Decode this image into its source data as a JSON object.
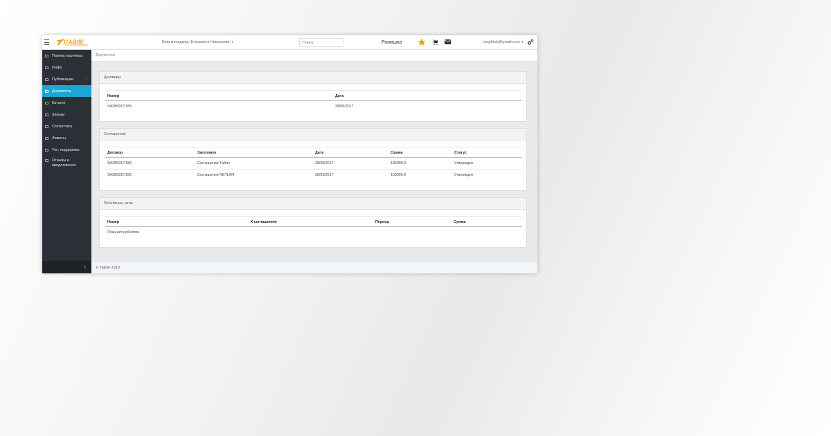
{
  "header": {
    "logo_text": "ТАЙЛЕ",
    "manager_text": "Ваш менеджер: Елизавета Николаева",
    "search_placeholder": "Поиск",
    "company": "Ромашка",
    "user_email": "rozyjblnlx@gmail.com",
    "accent_color": "#f39c12"
  },
  "sidebar": {
    "items": [
      {
        "label": "Панель партнера",
        "icon": "dashboard-icon"
      },
      {
        "label": "Инфо",
        "icon": "info-icon"
      },
      {
        "label": "Публикации",
        "icon": "publications-icon",
        "has_submenu": true
      },
      {
        "label": "Документы",
        "icon": "documents-icon",
        "active": true
      },
      {
        "label": "Каталог",
        "icon": "catalog-icon",
        "has_submenu": true
      },
      {
        "label": "Заказы",
        "icon": "orders-icon"
      },
      {
        "label": "Статистика",
        "icon": "statistics-icon"
      },
      {
        "label": "Лимиты",
        "icon": "limits-icon"
      },
      {
        "label": "Тех. поддержка",
        "icon": "support-icon"
      },
      {
        "label": "Отзывы и предложения",
        "icon": "feedback-icon"
      }
    ],
    "active_color": "#19a7d6",
    "background_color": "#2b2f36"
  },
  "breadcrumb": "Документы",
  "contracts": {
    "title": "Договоры",
    "columns": [
      "Номер",
      "Дата"
    ],
    "rows": [
      [
        "SA280917/186",
        "28/09/2017"
      ]
    ]
  },
  "agreements": {
    "title": "Соглашение",
    "columns": [
      "Договор",
      "Заголовок",
      "Дата",
      "Сумма",
      "Статус"
    ],
    "rows": [
      [
        "SA280917/186",
        "Соглашение Тайле",
        "28/09/2017",
        "180000.0",
        "Утвержден"
      ],
      [
        "SA280917/186",
        "Соглашение NETLAN",
        "28/09/2017",
        "150000.0",
        "Утвержден"
      ]
    ]
  },
  "rebates": {
    "title": "Ребейтные акты",
    "columns": [
      "Номер",
      "К соглашению",
      "Период",
      "Сумма"
    ],
    "empty_text": "Пока нет ребейтов"
  },
  "footer": "© Тайле 2019"
}
